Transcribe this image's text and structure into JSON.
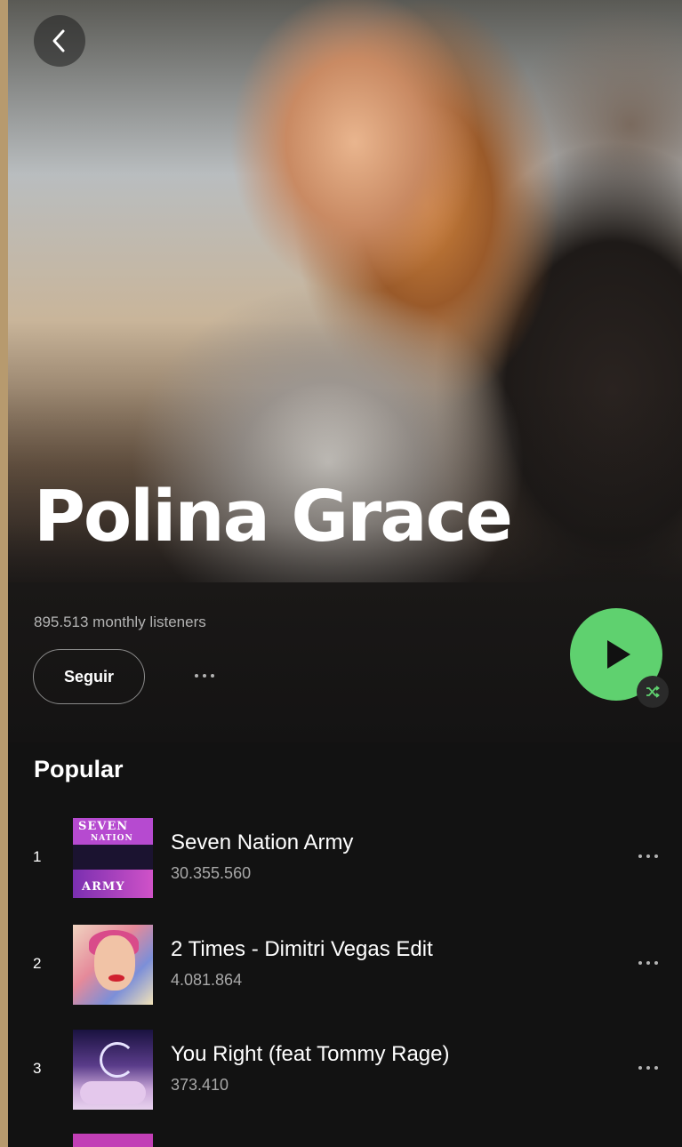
{
  "header": {
    "back_icon": "chevron-left-icon"
  },
  "artist": {
    "name": "Polina Grace",
    "monthly_listeners": "895.513 monthly listeners"
  },
  "actions": {
    "follow_label": "Seguir",
    "more_icon": "more-horizontal-icon",
    "play_icon": "play-icon",
    "shuffle_icon": "shuffle-icon",
    "accent_color": "#5fd16f"
  },
  "popular": {
    "title": "Popular",
    "tracks": [
      {
        "number": "1",
        "title": "Seven Nation Army",
        "plays": "30.355.560",
        "cover_text_top": "SEVEN",
        "cover_text_mid": "NATION",
        "cover_text_bottom": "ARMY"
      },
      {
        "number": "2",
        "title": "2 Times - Dimitri Vegas Edit",
        "plays": "4.081.864"
      },
      {
        "number": "3",
        "title": "You Right (feat Tommy Rage)",
        "plays": "373.410"
      }
    ]
  }
}
